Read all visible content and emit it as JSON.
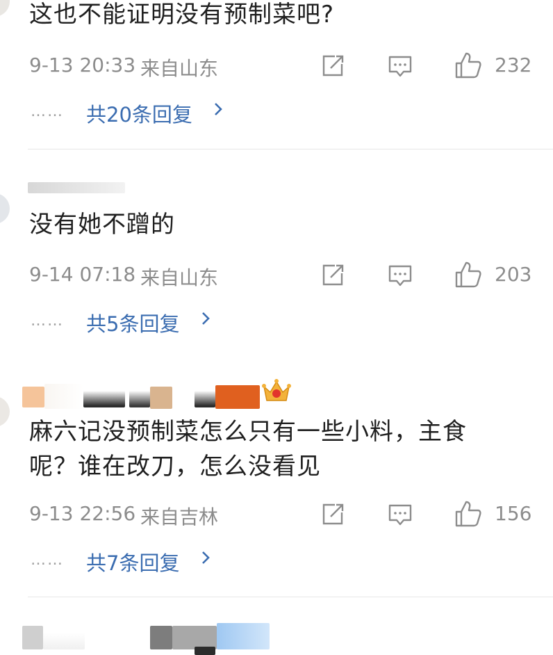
{
  "comments": [
    {
      "text": "这也不能证明没有预制菜吧?",
      "time": "9-13 20:33",
      "location": "来自山东",
      "likes": "232",
      "replies": "共20条回复",
      "dots": "……"
    },
    {
      "text": "没有她不蹭的",
      "time": "9-14 07:18",
      "location": "来自山东",
      "likes": "203",
      "replies": "共5条回复",
      "dots": "……"
    },
    {
      "text_line1": "麻六记没预制菜怎么只有一些小料，主食",
      "text_line2": "呢？谁在改刀，怎么没看见",
      "time": "9-13 22:56",
      "location": "来自吉林",
      "likes": "156",
      "replies": "共7条回复",
      "dots": "……"
    }
  ],
  "icons": {
    "share": "share-icon",
    "comment": "comment-icon",
    "like": "thumbs-up-icon",
    "chevron": "chevron-right-icon",
    "crown": "crown-icon"
  },
  "colors": {
    "reply_link": "#3a6cb0",
    "meta": "#8c8c8c",
    "text": "#1f1f1f"
  }
}
